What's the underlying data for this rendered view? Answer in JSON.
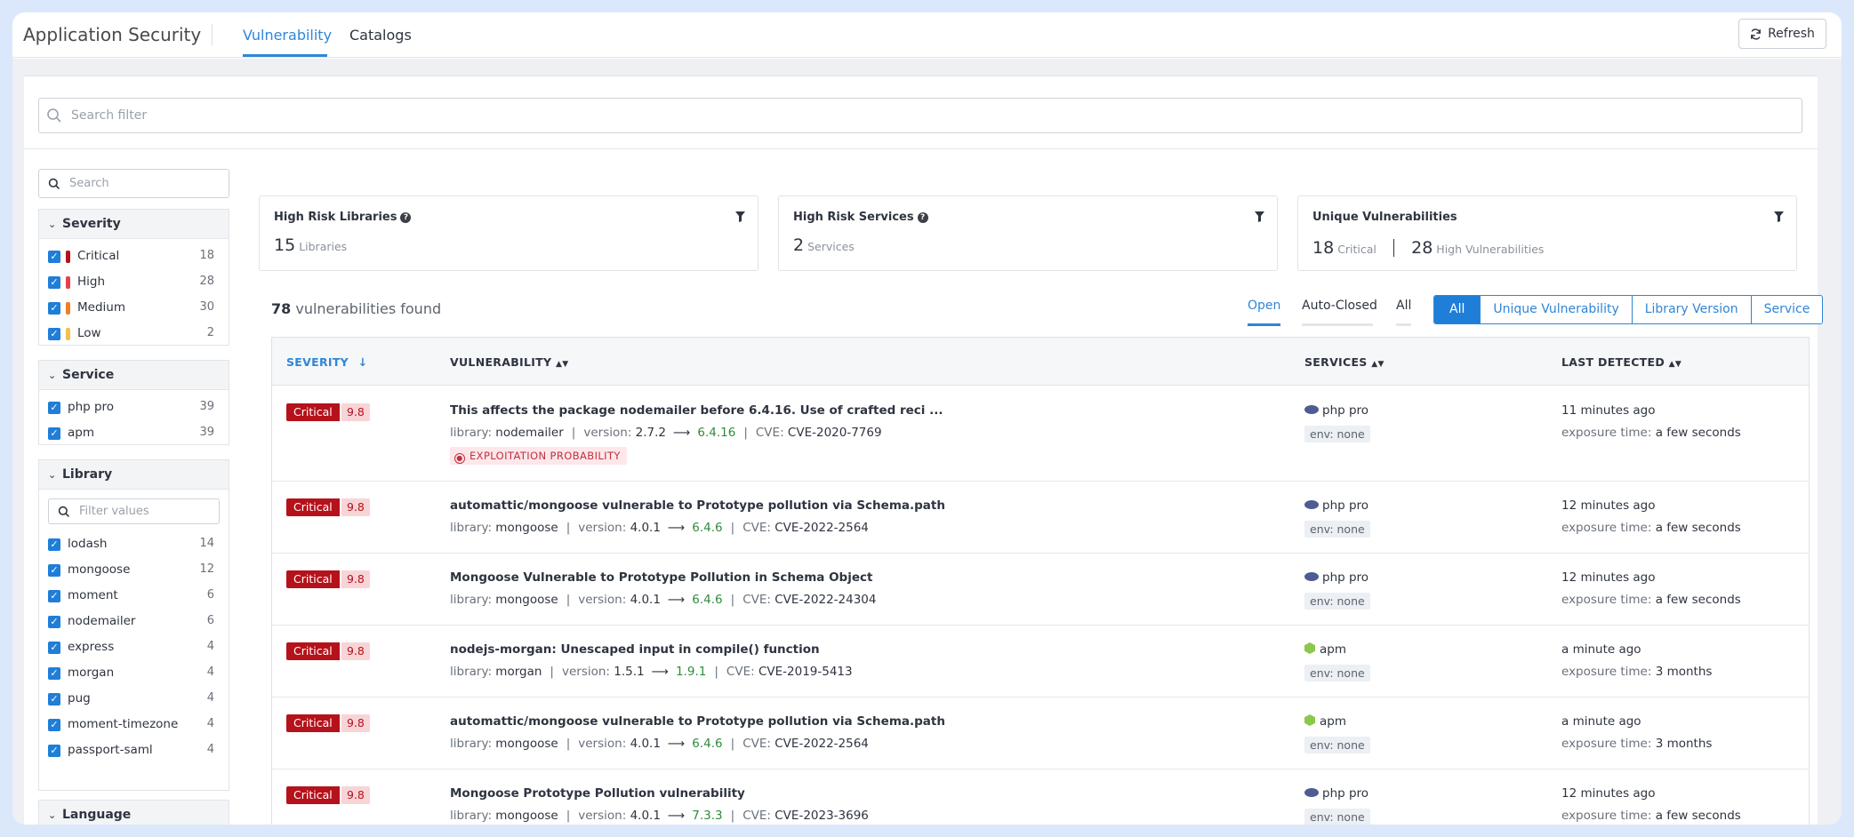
{
  "header": {
    "app_title": "Application Security",
    "tabs": [
      {
        "label": "Vulnerability"
      },
      {
        "label": "Catalogs"
      }
    ],
    "refresh_label": "Refresh"
  },
  "search": {
    "placeholder": "Search filter"
  },
  "sidebar": {
    "search_placeholder": "Search",
    "severity": {
      "title": "Severity",
      "items": [
        {
          "label": "Critical",
          "count": "18",
          "color": "#b5121b"
        },
        {
          "label": "High",
          "count": "28",
          "color": "#e2424f"
        },
        {
          "label": "Medium",
          "count": "30",
          "color": "#f07f22"
        },
        {
          "label": "Low",
          "count": "2",
          "color": "#f3c04b"
        }
      ]
    },
    "service": {
      "title": "Service",
      "items": [
        {
          "label": "php pro",
          "count": "39"
        },
        {
          "label": "apm",
          "count": "39"
        }
      ]
    },
    "library": {
      "title": "Library",
      "filter_placeholder": "Filter values",
      "items": [
        {
          "label": "lodash",
          "count": "14"
        },
        {
          "label": "mongoose",
          "count": "12"
        },
        {
          "label": "moment",
          "count": "6"
        },
        {
          "label": "nodemailer",
          "count": "6"
        },
        {
          "label": "express",
          "count": "4"
        },
        {
          "label": "morgan",
          "count": "4"
        },
        {
          "label": "pug",
          "count": "4"
        },
        {
          "label": "moment-timezone",
          "count": "4"
        },
        {
          "label": "passport-saml",
          "count": "4"
        }
      ]
    },
    "language": {
      "title": "Language"
    }
  },
  "stats": {
    "libraries": {
      "title": "High Risk Libraries",
      "value": "15",
      "unit": "Libraries"
    },
    "services": {
      "title": "High Risk Services",
      "value": "2",
      "unit": "Services"
    },
    "unique": {
      "title": "Unique Vulnerabilities",
      "critical_value": "18",
      "critical_unit": "Critical",
      "high_value": "28",
      "high_unit": "High Vulnerabilities"
    }
  },
  "results": {
    "count": "78",
    "count_label": "vulnerabilities found",
    "state_tabs": [
      "Open",
      "Auto-Closed",
      "All"
    ],
    "group_options": [
      "All",
      "Unique Vulnerability",
      "Library Version",
      "Service"
    ]
  },
  "table": {
    "headers": {
      "severity": "SEVERITY",
      "vulnerability": "VULNERABILITY",
      "services": "SERVICES",
      "last_detected": "LAST DETECTED"
    },
    "meta_labels": {
      "library": "library:",
      "version": "version:",
      "cve": "CVE:",
      "exposure": "exposure time:"
    },
    "rows": [
      {
        "severity": "Critical",
        "score": "9.8",
        "title": "This affects the package nodemailer before 6.4.16. Use of crafted reci ...",
        "library": "nodemailer",
        "version": "2.7.2",
        "fixed": "6.4.16",
        "cve": "CVE-2020-7769",
        "exploit": "EXPLOITATION PROBABILITY",
        "service": "php pro",
        "service_icon": "php-icon",
        "env": "env: none",
        "last": "11 minutes ago",
        "exposure": "a few seconds"
      },
      {
        "severity": "Critical",
        "score": "9.8",
        "title": "automattic/mongoose vulnerable to Prototype pollution via Schema.path",
        "library": "mongoose",
        "version": "4.0.1",
        "fixed": "6.4.6",
        "cve": "CVE-2022-2564",
        "exploit": "",
        "service": "php pro",
        "service_icon": "php-icon",
        "env": "env: none",
        "last": "12 minutes ago",
        "exposure": "a few seconds"
      },
      {
        "severity": "Critical",
        "score": "9.8",
        "title": "Mongoose Vulnerable to Prototype Pollution in Schema Object",
        "library": "mongoose",
        "version": "4.0.1",
        "fixed": "6.4.6",
        "cve": "CVE-2022-24304",
        "exploit": "",
        "service": "php pro",
        "service_icon": "php-icon",
        "env": "env: none",
        "last": "12 minutes ago",
        "exposure": "a few seconds"
      },
      {
        "severity": "Critical",
        "score": "9.8",
        "title": "nodejs-morgan: Unescaped input in compile() function",
        "library": "morgan",
        "version": "1.5.1",
        "fixed": "1.9.1",
        "cve": "CVE-2019-5413",
        "exploit": "",
        "service": "apm",
        "service_icon": "nodejs-icon",
        "env": "env: none",
        "last": "a minute ago",
        "exposure": "3 months"
      },
      {
        "severity": "Critical",
        "score": "9.8",
        "title": "automattic/mongoose vulnerable to Prototype pollution via Schema.path",
        "library": "mongoose",
        "version": "4.0.1",
        "fixed": "6.4.6",
        "cve": "CVE-2022-2564",
        "exploit": "",
        "service": "apm",
        "service_icon": "nodejs-icon",
        "env": "env: none",
        "last": "a minute ago",
        "exposure": "3 months"
      },
      {
        "severity": "Critical",
        "score": "9.8",
        "title": "Mongoose Prototype Pollution vulnerability",
        "library": "mongoose",
        "version": "4.0.1",
        "fixed": "7.3.3",
        "cve": "CVE-2023-3696",
        "exploit": "",
        "service": "php pro",
        "service_icon": "php-icon",
        "env": "env: none",
        "last": "12 minutes ago",
        "exposure": "a few seconds"
      }
    ]
  }
}
